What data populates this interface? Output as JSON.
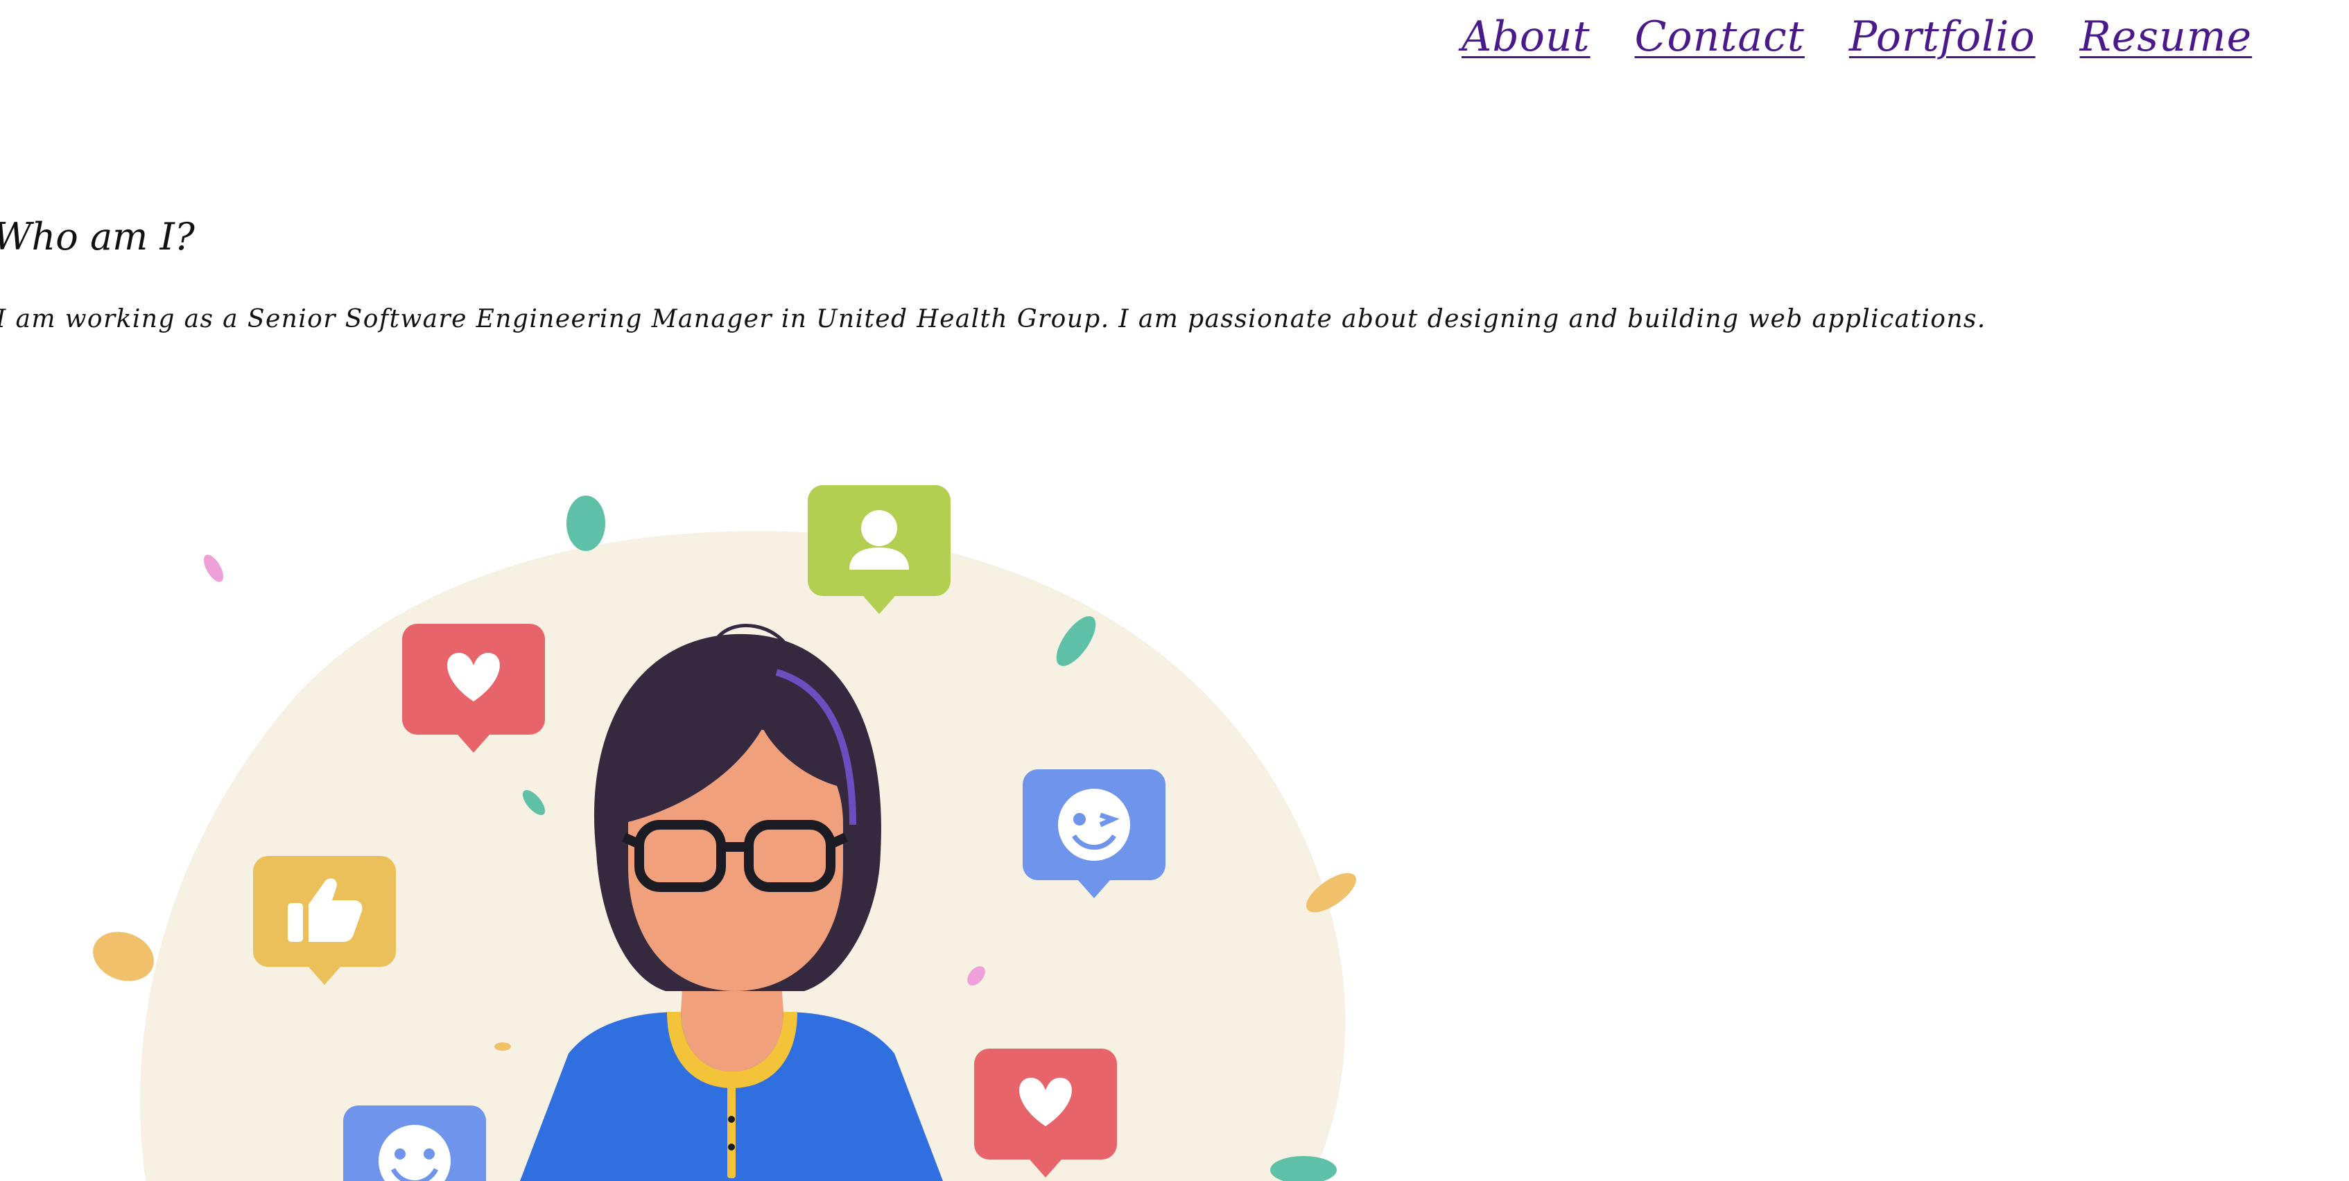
{
  "nav": {
    "links": [
      {
        "label": "About"
      },
      {
        "label": "Contact"
      },
      {
        "label": "Portfolio"
      },
      {
        "label": "Resume"
      }
    ]
  },
  "about": {
    "heading": "Who am I?",
    "intro": "I am working as a Senior Software Engineering Manager in United Health Group. I am passionate about designing and building web applications."
  },
  "illustration": {
    "colors": {
      "blob": "#f6f1e2",
      "heart_bubble": "#e8646b",
      "profile_bubble": "#b2cf52",
      "wink_bubble": "#6f94ec",
      "thumbs_bubble": "#ebc05a",
      "hair": "#35293f",
      "skin": "#f0a07a",
      "shirt": "#2f6fe0",
      "collar": "#f3c43a",
      "leaf_teal": "#5fc0a8",
      "leaf_yellow": "#f0c06a",
      "leaf_pink": "#f0a0d8"
    },
    "icons": [
      "heart-icon",
      "user-icon",
      "wink-face-icon",
      "thumbs-up-icon",
      "smile-face-icon",
      "heart-icon"
    ]
  }
}
